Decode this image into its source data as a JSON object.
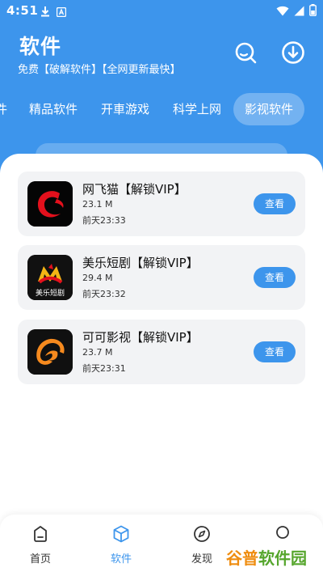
{
  "status_bar": {
    "time": "4:51"
  },
  "header": {
    "title": "软件",
    "subtitle": "免费【破解软件】【全网更新最快】"
  },
  "tabs": [
    {
      "label": "件"
    },
    {
      "label": "精品软件"
    },
    {
      "label": "开車游戏"
    },
    {
      "label": "科学上网"
    },
    {
      "label": "影视软件",
      "active": true
    }
  ],
  "apps": [
    {
      "name": "网飞猫【解锁VIP】",
      "size": "23.1 M",
      "time": "前天23:33",
      "action": "查看",
      "icon": "netflix-cat-logo"
    },
    {
      "name": "美乐短剧【解锁VIP】",
      "size": "29.4 M",
      "time": "前天23:32",
      "action": "查看",
      "icon": "meile-drama-logo",
      "icon_text": "美乐短剧"
    },
    {
      "name": "可可影视【解锁VIP】",
      "size": "23.7 M",
      "time": "前天23:31",
      "action": "查看",
      "icon": "keke-video-logo"
    }
  ],
  "bottom_nav": [
    {
      "label": "首页",
      "icon": "home-icon"
    },
    {
      "label": "软件",
      "icon": "cube-icon",
      "active": true
    },
    {
      "label": "发现",
      "icon": "compass-icon"
    },
    {
      "label": "",
      "icon": "user-icon"
    }
  ],
  "watermark": {
    "text_a": "谷普",
    "text_b": "软件园"
  },
  "colors": {
    "primary": "#3d95ec",
    "card_bg": "#f2f3f5",
    "text_dark": "#111111"
  }
}
